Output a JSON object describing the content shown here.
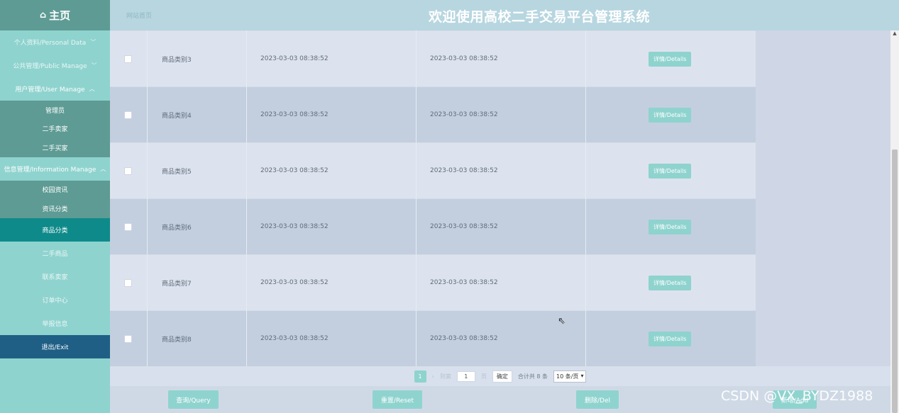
{
  "header": {
    "home_label": "主页",
    "site_label": "网站首页",
    "title": "欢迎使用高校二手交易平台管理系统"
  },
  "sidebar": {
    "groups": [
      {
        "label": "个人资料/Personal Data"
      },
      {
        "label": "公共管理/Public Manage"
      },
      {
        "label": "用户管理/User Manage"
      },
      {
        "label": "信息管理/Information Manage"
      }
    ],
    "user_items": [
      "管理员",
      "二手卖家",
      "二手买家"
    ],
    "info_items": [
      "校园资讯",
      "资讯分类"
    ],
    "items": [
      "商品分类",
      "二手商品",
      "联系卖家",
      "订单中心",
      "举报信息"
    ],
    "exit_label": "退出/Exit"
  },
  "table": {
    "rows": [
      {
        "name": "商品类别3",
        "created": "2023-03-03 08:38:52",
        "updated": "2023-03-03 08:38:52",
        "action": "详情/Details"
      },
      {
        "name": "商品类别4",
        "created": "2023-03-03 08:38:52",
        "updated": "2023-03-03 08:38:52",
        "action": "详情/Details"
      },
      {
        "name": "商品类别5",
        "created": "2023-03-03 08:38:52",
        "updated": "2023-03-03 08:38:52",
        "action": "详情/Details"
      },
      {
        "name": "商品类别6",
        "created": "2023-03-03 08:38:52",
        "updated": "2023-03-03 08:38:52",
        "action": "详情/Details"
      },
      {
        "name": "商品类别7",
        "created": "2023-03-03 08:38:52",
        "updated": "2023-03-03 08:38:52",
        "action": "详情/Details"
      },
      {
        "name": "商品类别8",
        "created": "2023-03-03 08:38:52",
        "updated": "2023-03-03 08:38:52",
        "action": "详情/Details"
      }
    ]
  },
  "pager": {
    "current": "1",
    "goto_label": "到第",
    "goto_value": "1",
    "page_suffix": "页",
    "confirm": "确定",
    "total": "合计共 8 条",
    "page_size": "10 条/页"
  },
  "actions": {
    "query": "查询/Query",
    "reset": "重置/Reset",
    "delete": "删除/Del",
    "add": "新增/Add"
  },
  "watermark": "CSDN @VX_BYDZ1988",
  "colors": {
    "accent": "#8fd3cf",
    "sidebar_dark": "#5e9b94",
    "active": "#0f8a8a",
    "exit": "#1f5f86"
  }
}
